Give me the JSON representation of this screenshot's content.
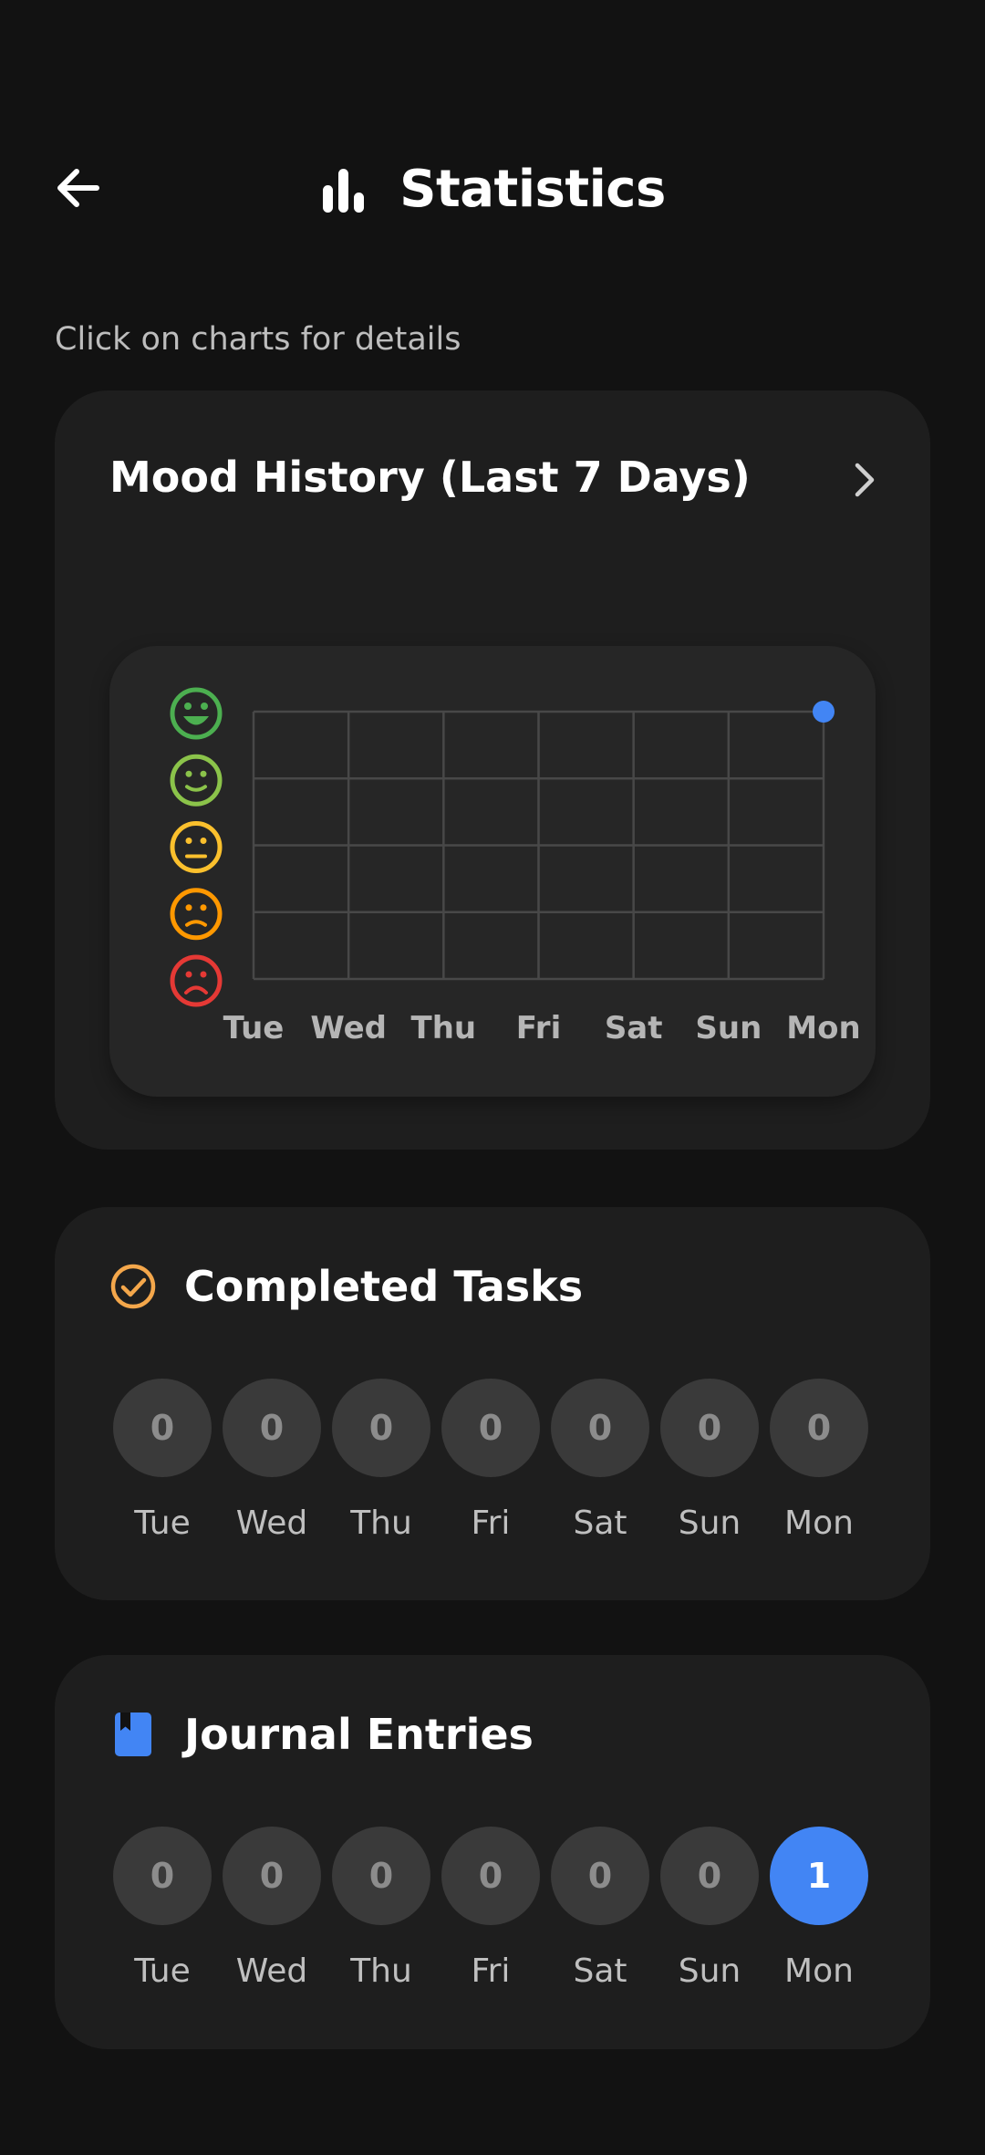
{
  "header": {
    "title": "Statistics",
    "back_icon": "arrow-left-icon",
    "title_icon": "bar-chart-icon"
  },
  "hint": "Click on charts for details",
  "mood": {
    "title": "Mood History (Last 7 Days)",
    "chevron_icon": "chevron-right-icon",
    "mood_levels": [
      {
        "icon": "very-happy-face-icon",
        "color": "#4CAF50"
      },
      {
        "icon": "happy-face-icon",
        "color": "#8BC34A"
      },
      {
        "icon": "neutral-face-icon",
        "color": "#FBC02D"
      },
      {
        "icon": "slightly-sad-face-icon",
        "color": "#FF9800"
      },
      {
        "icon": "sad-face-icon",
        "color": "#E53935"
      }
    ]
  },
  "chart_data": {
    "type": "scatter",
    "categories": [
      "Tue",
      "Wed",
      "Thu",
      "Fri",
      "Sat",
      "Sun",
      "Mon"
    ],
    "series": [
      {
        "values": [
          null,
          null,
          null,
          null,
          null,
          null,
          5
        ],
        "color": "#4285F4"
      }
    ],
    "ylim": [
      1,
      5
    ],
    "y_scale": "mood levels 1 (sad) to 5 (very happy), shown as face icons",
    "grid": true
  },
  "tasks": {
    "title": "Completed Tasks",
    "icon": "check-circle-icon",
    "icon_color": "#F4A74B",
    "days": [
      {
        "label": "Tue",
        "value": "0"
      },
      {
        "label": "Wed",
        "value": "0"
      },
      {
        "label": "Thu",
        "value": "0"
      },
      {
        "label": "Fri",
        "value": "0"
      },
      {
        "label": "Sat",
        "value": "0"
      },
      {
        "label": "Sun",
        "value": "0"
      },
      {
        "label": "Mon",
        "value": "0"
      }
    ]
  },
  "journal": {
    "title": "Journal Entries",
    "icon": "bookmark-book-icon",
    "icon_color": "#4285F4",
    "days": [
      {
        "label": "Tue",
        "value": "0"
      },
      {
        "label": "Wed",
        "value": "0"
      },
      {
        "label": "Thu",
        "value": "0"
      },
      {
        "label": "Fri",
        "value": "0"
      },
      {
        "label": "Sat",
        "value": "0"
      },
      {
        "label": "Sun",
        "value": "0"
      },
      {
        "label": "Mon",
        "value": "1",
        "active": true
      }
    ]
  }
}
